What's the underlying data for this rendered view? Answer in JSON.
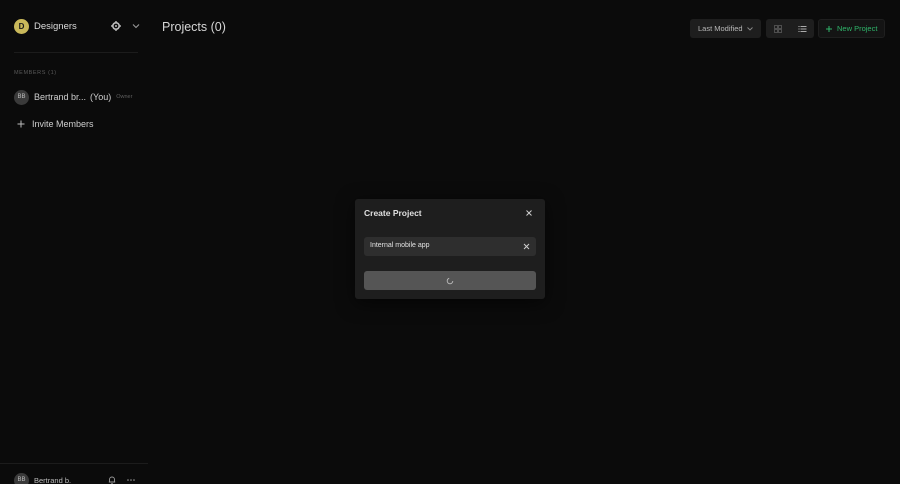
{
  "sidebar": {
    "team": {
      "initial": "D",
      "name": "Designers"
    },
    "members_heading": "MEMBERS (1)",
    "members": [
      {
        "initials": "BB",
        "name": "Bertrand br...",
        "you_label": "(You)",
        "role": "Owner"
      }
    ],
    "invite_label": "Invite Members",
    "current_user": {
      "initials": "BB",
      "name": "Bertrand b."
    }
  },
  "header": {
    "title": "Projects (0)",
    "sort_label": "Last Modified",
    "new_project_label": "New Project"
  },
  "modal": {
    "title": "Create Project",
    "input_value": "Internal mobile app"
  },
  "colors": {
    "background": "#0b0b0b",
    "team_avatar": "#c9b85a",
    "accent_green": "#2fb56a",
    "modal_bg": "#1e1e1e"
  }
}
